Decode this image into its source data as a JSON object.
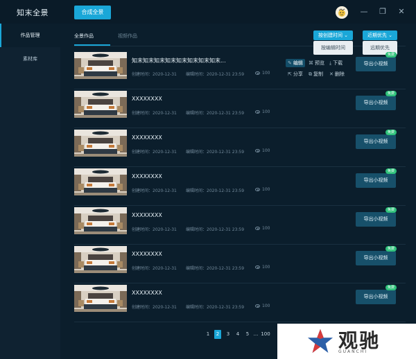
{
  "app": {
    "title": "知末全景",
    "compose_button": "合成全景"
  },
  "window_controls": {
    "minimize": "—",
    "maximize": "❐",
    "close": "✕"
  },
  "sidebar": {
    "items": [
      {
        "label": "作品管理"
      },
      {
        "label": "素材库"
      }
    ]
  },
  "tabs": [
    {
      "label": "全景作品"
    },
    {
      "label": "视频作品"
    }
  ],
  "sort": {
    "primary": "按创建时间 ⌄",
    "primary_option": "按编辑时间",
    "secondary": "近期优先 ⌄",
    "secondary_option": "远期优先"
  },
  "actions": {
    "edit": "编辑",
    "preview": "预览",
    "download": "下载",
    "share": "分享",
    "copy": "复制",
    "delete": "删除"
  },
  "export_label": "导出小视频",
  "badge_label": "免费",
  "rows": [
    {
      "title": "知末知末知末知末知末知末知末知末...",
      "created": "创建时间：2020-12-31",
      "edited": "编辑时间：2020-12-31 23:59",
      "views": "100"
    },
    {
      "title": "XXXXXXXX",
      "created": "创建时间：2020-12-31",
      "edited": "编辑时间：2020-12-31 23:59",
      "views": "100"
    },
    {
      "title": "XXXXXXXX",
      "created": "创建时间：2020-12-31",
      "edited": "编辑时间：2020-12-31 23:59",
      "views": "100"
    },
    {
      "title": "XXXXXXXX",
      "created": "创建时间：2020-12-31",
      "edited": "编辑时间：2020-12-31 23:59",
      "views": "100"
    },
    {
      "title": "XXXXXXXX",
      "created": "创建时间：2020-12-31",
      "edited": "编辑时间：2020-12-31 23:59",
      "views": "100"
    },
    {
      "title": "XXXXXXXX",
      "created": "创建时间：2020-12-31",
      "edited": "编辑时间：2020-12-31 23:59",
      "views": "100"
    },
    {
      "title": "XXXXXXXX",
      "created": "创建时间：2020-12-31",
      "edited": "编辑时间：2020-12-31 23:59",
      "views": "100"
    }
  ],
  "pagination": {
    "pages": [
      "1",
      "2",
      "3",
      "4",
      "5",
      "...",
      "100"
    ],
    "current": "2"
  },
  "watermark": {
    "text": "观驰",
    "sub": "GUANCHI"
  },
  "colors": {
    "accent": "#1aa7d8",
    "badge": "#2ec17a",
    "background": "#0b1e2c"
  }
}
